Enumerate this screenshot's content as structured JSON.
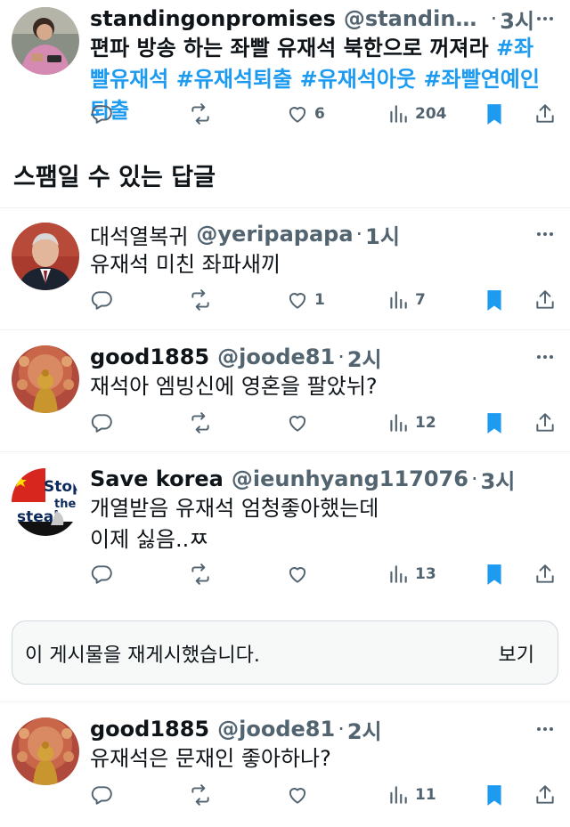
{
  "main_tweet": {
    "name": "standingonpromises",
    "handle": "@standingo...",
    "dot": "·",
    "time": "3시",
    "text": "편파 방송 하는 좌빨 유재석 북한으로 꺼져라 ",
    "hashtags": [
      "#좌빨유재석",
      "#유재석퇴출",
      "#유재석아웃",
      "#좌빨연예인퇴출"
    ],
    "likes": "6",
    "views": "204"
  },
  "section": {
    "title": "스팸일 수 있는 답글"
  },
  "replies": [
    {
      "name": "대석열복귀",
      "handle": "@yeripapapa",
      "dot": "·",
      "time": "1시",
      "text": "유재석 미친 좌파새끼",
      "likes": "1",
      "views": "7"
    },
    {
      "name": "good1885",
      "handle": "@joode81",
      "dot": "·",
      "time": "2시",
      "text": "재석아 엠빙신에 영혼을 팔았뉘?",
      "likes": "",
      "views": "12"
    },
    {
      "name": "Save korea",
      "handle": "@ieunhyang117076",
      "dot": "·",
      "time": "3시",
      "text": "개열받음 유재석 엄청좋아했는데\n이제 싫음..ㅉ",
      "likes": "",
      "views": "13"
    },
    {
      "name": "good1885",
      "handle": "@joode81",
      "dot": "·",
      "time": "2시",
      "text": "유재석은 문재인 좋아하나?",
      "likes": "",
      "views": "11"
    }
  ],
  "reposted_notice": {
    "message": "이 게시물을 재게시했습니다.",
    "view_label": "보기"
  },
  "avatar_text": {
    "stop": "Stop",
    "the": "the",
    "steal": "steal"
  },
  "colors": {
    "accent": "#1d9bf0",
    "muted": "#536471",
    "text": "#0f1419",
    "border": "#eff3f4",
    "bookmark": "#1d9bf0"
  },
  "icons": [
    "reply-icon",
    "repost-icon",
    "like-icon",
    "views-icon",
    "bookmark-icon",
    "share-icon",
    "more-icon"
  ]
}
